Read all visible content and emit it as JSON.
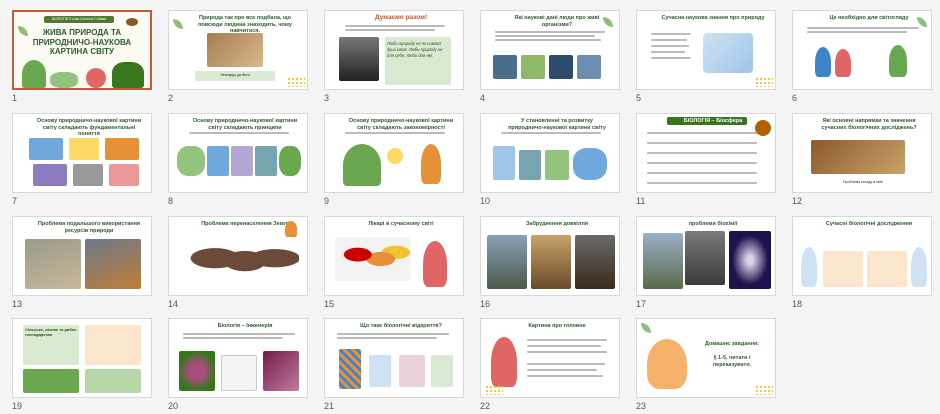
{
  "app": "Slide Sorter",
  "slides": [
    {
      "number": "1",
      "badge": "БІОЛОГІЯ 5 клас  Біологія Собаки",
      "title": "ЖИВА ПРИРОДА ТА ПРИРОДНИЧО-НАУКОВА КАРТИНА СВІТУ"
    },
    {
      "number": "2",
      "title": "Природа так про все подбала, що повсюди людина знаходить, чому навчитися.",
      "caption": "Леонардо да Вінчі"
    },
    {
      "number": "3",
      "title": "Думаємо разом!",
      "quote": "Люби природу не як символ душі своєї. Люби природу не для себе. Люби для неї."
    },
    {
      "number": "4",
      "title": "Які наукові дані люди про живі організми?"
    },
    {
      "number": "5",
      "title": "Сучасна наукова знання про природу"
    },
    {
      "number": "6",
      "title": "Це необхідно для світогляду"
    },
    {
      "number": "7",
      "title": "Основу природничо-наукової картини світу складають фундаментальні поняття"
    },
    {
      "number": "8",
      "title": "Основу природничо-наукової картини світу складають принципи"
    },
    {
      "number": "9",
      "title": "Основу природничо-наукової картини світу складають закономірності"
    },
    {
      "number": "10",
      "title": "У становленні та розвитку природничо-наукової картини світу"
    },
    {
      "number": "11",
      "title": "БІОЛОГІЯ – Біосфера"
    },
    {
      "number": "12",
      "title": "Які основні напрямки та значення сучасних біологічних досліджень?",
      "caption": "Проблема голоду в світі"
    },
    {
      "number": "13",
      "title": "Проблема подальшого використання ресурсів природи"
    },
    {
      "number": "14",
      "title": "Проблема перенаселення Землі"
    },
    {
      "number": "15",
      "title": "Лікарі в сучасному світі"
    },
    {
      "number": "16",
      "title": "Забруднення довкілля"
    },
    {
      "number": "17",
      "title": "проблеми біохімії"
    },
    {
      "number": "18",
      "title": "Сучасні біологічні дослідження"
    },
    {
      "number": "19",
      "title": "Сільське, лісове та рибне господарство"
    },
    {
      "number": "20",
      "title": "Біологія – Інженерія"
    },
    {
      "number": "21",
      "title": "Що таке біологічні відкриття?"
    },
    {
      "number": "22",
      "title": "Картина про головне"
    },
    {
      "number": "23",
      "title": "Домашнє завдання:",
      "body": "§ 1-5, читати і переказувати."
    }
  ],
  "colors": {
    "accent": "#c55a33",
    "green": "#2f5d2c",
    "yellow": "#f1c232"
  }
}
